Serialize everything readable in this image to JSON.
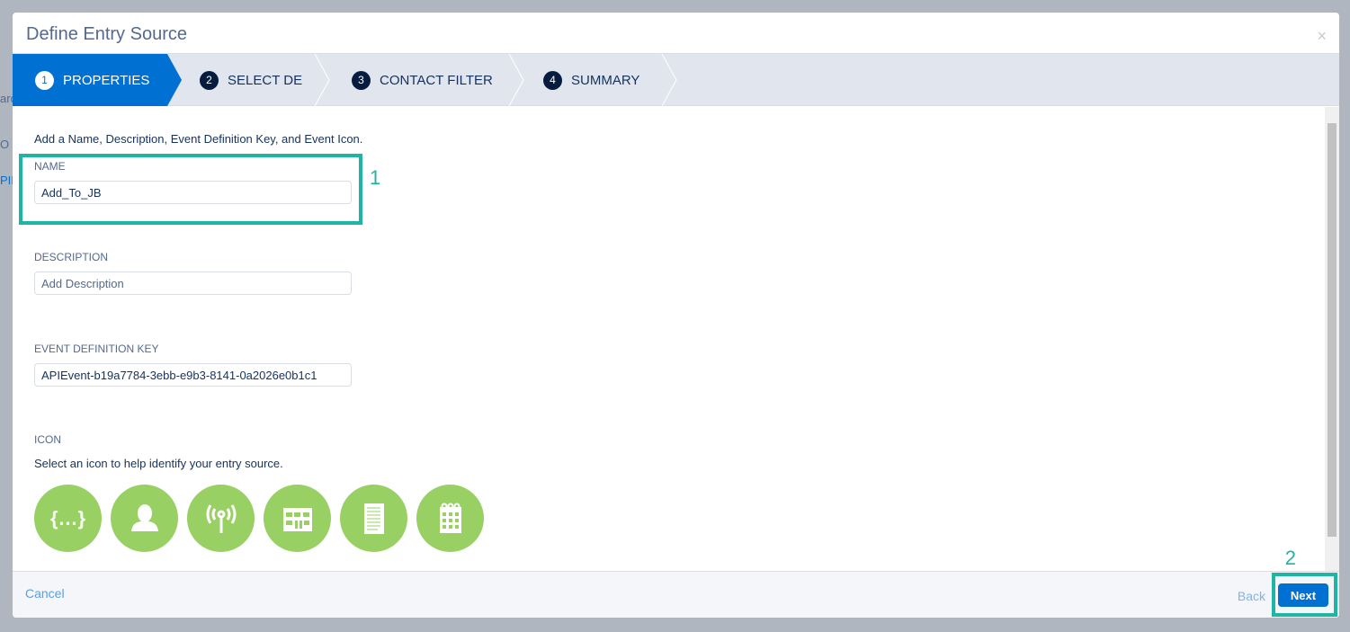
{
  "background": {
    "fragments": [
      "arc",
      "O",
      "PII"
    ]
  },
  "modal": {
    "title": "Define Entry Source",
    "close": "×"
  },
  "steps": [
    {
      "num": "1",
      "label": "PROPERTIES",
      "active": true
    },
    {
      "num": "2",
      "label": "SELECT DE"
    },
    {
      "num": "3",
      "label": "CONTACT FILTER"
    },
    {
      "num": "4",
      "label": "SUMMARY"
    }
  ],
  "form": {
    "intro": "Add a Name, Description, Event Definition Key, and Event Icon.",
    "name_label": "NAME",
    "name_value": "Add_To_JB",
    "description_label": "DESCRIPTION",
    "description_placeholder": "Add Description",
    "key_label": "EVENT DEFINITION KEY",
    "key_value": "APIEvent-b19a7784-3ebb-e9b3-8141-0a2026e0b1c1",
    "icon_label": "ICON",
    "icon_help": "Select an icon to help identify your entry source.",
    "icons": [
      "code-braces-icon",
      "person-icon",
      "antenna-icon",
      "building-icon",
      "document-icon",
      "calendar-icon"
    ],
    "icon_color": "#98d063"
  },
  "annotations": {
    "one": "1",
    "two": "2",
    "color": "#1fb5a4"
  },
  "footer": {
    "cancel": "Cancel",
    "back": "Back",
    "next": "Next"
  }
}
